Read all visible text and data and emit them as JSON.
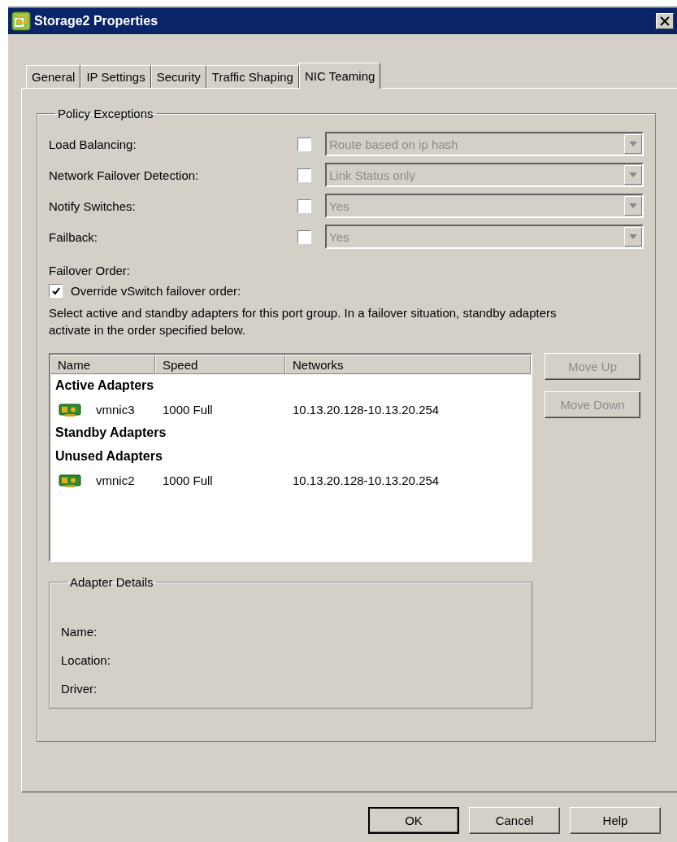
{
  "window": {
    "title": "Storage2 Properties"
  },
  "tabs": [
    {
      "label": "General",
      "selected": false
    },
    {
      "label": "IP Settings",
      "selected": false
    },
    {
      "label": "Security",
      "selected": false
    },
    {
      "label": "Traffic Shaping",
      "selected": false
    },
    {
      "label": "NIC Teaming",
      "selected": true
    }
  ],
  "policy_exceptions": {
    "title": "Policy Exceptions",
    "rows": [
      {
        "label": "Load Balancing:",
        "checked": false,
        "value": "Route based on ip hash",
        "disabled": true
      },
      {
        "label": "Network Failover Detection:",
        "checked": false,
        "value": "Link Status only",
        "disabled": true
      },
      {
        "label": "Notify Switches:",
        "checked": false,
        "value": "Yes",
        "disabled": true
      },
      {
        "label": "Failback:",
        "checked": false,
        "value": "Yes",
        "disabled": true
      }
    ]
  },
  "failover_order": {
    "label": "Failover Order:",
    "override": {
      "label": "Override vSwitch failover order:",
      "checked": true
    },
    "description": "Select active and standby adapters for this port group.  In a failover situation, standby adapters activate  in the order specified below."
  },
  "adapters": {
    "columns": [
      "Name",
      "Speed",
      "Networks"
    ],
    "rows": [
      {
        "kind": "group",
        "label": "Active Adapters"
      },
      {
        "kind": "adapter",
        "name": "vmnic3",
        "speed": "1000 Full",
        "networks": "10.13.20.128-10.13.20.254"
      },
      {
        "kind": "group",
        "label": "Standby Adapters"
      },
      {
        "kind": "group",
        "label": "Unused Adapters"
      },
      {
        "kind": "adapter",
        "name": "vmnic2",
        "speed": "1000 Full",
        "networks": "10.13.20.128-10.13.20.254"
      }
    ]
  },
  "move_buttons": [
    {
      "label": "Move Up",
      "disabled": true
    },
    {
      "label": "Move Down",
      "disabled": true
    }
  ],
  "adapter_details": {
    "title": "Adapter Details",
    "fields": [
      "Name:",
      "Location:",
      "Driver:"
    ]
  },
  "buttons": [
    {
      "label": "OK",
      "default": true
    },
    {
      "label": "Cancel",
      "default": false
    },
    {
      "label": "Help",
      "default": false
    }
  ]
}
